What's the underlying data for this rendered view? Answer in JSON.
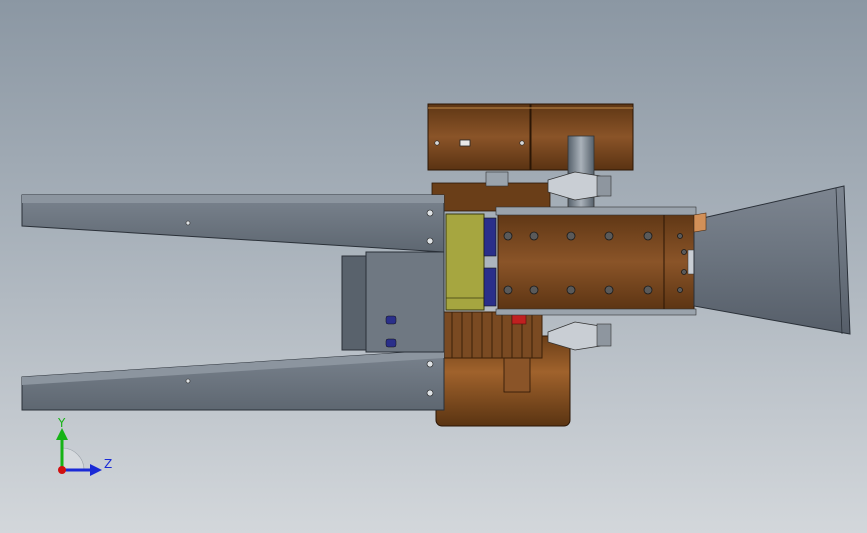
{
  "viewport": {
    "background_top": "#8b97a3",
    "background_bottom": "#d3d7db"
  },
  "model": {
    "colors": {
      "steel": "#6c7580",
      "steel_dark": "#3e4550",
      "bronze": "#7a4a22",
      "bronze_dark": "#4a2a10",
      "bronze_light": "#a86a32",
      "olive": "#a6a640",
      "blue": "#2a2f8a",
      "red": "#c02020",
      "light_steel": "#c9ced4"
    }
  },
  "triad": {
    "y_label": "Y",
    "z_label": "Z",
    "y_color": "#16b316",
    "z_color": "#1a2ad6",
    "origin_color": "#d01010"
  }
}
